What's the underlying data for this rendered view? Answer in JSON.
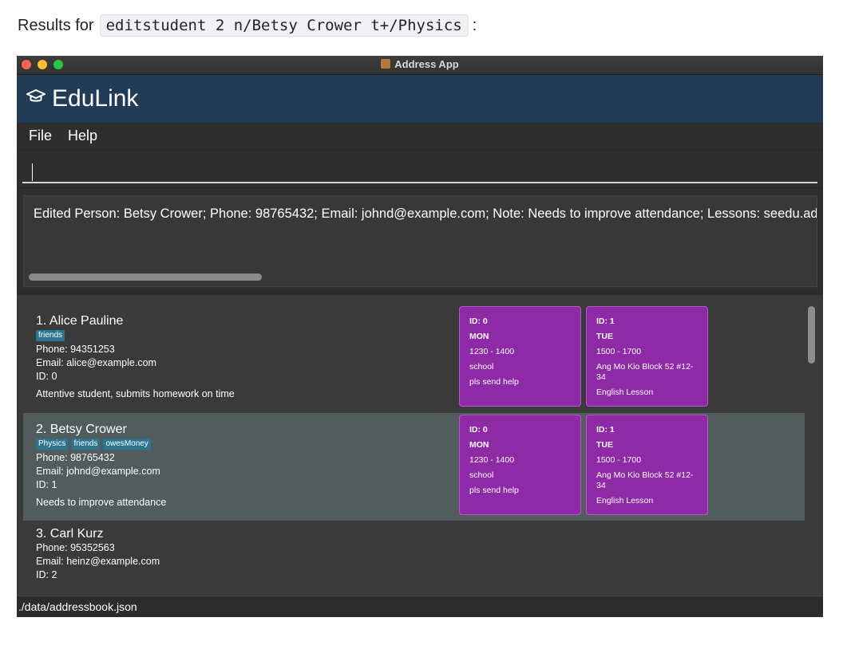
{
  "caption": {
    "prefix": "Results for",
    "command": "editstudent 2 n/Betsy Crower t+/Physics",
    "suffix": ":"
  },
  "window": {
    "title": "Address App"
  },
  "brand": {
    "icon": "graduation-cap-icon",
    "name": "EduLink"
  },
  "menu": {
    "file": "File",
    "help": "Help"
  },
  "command_box": {
    "value": "",
    "placeholder": ""
  },
  "result": {
    "text": "Edited Person: Betsy Crower; Phone: 98765432; Email: johnd@example.com; Note: Needs to improve attendance; Lessons: seedu.addressbook.model.lesson.Lesson"
  },
  "persons": [
    {
      "name": "1. Alice Pauline",
      "tags": [
        "friends"
      ],
      "phone": "Phone:  94351253",
      "email": "Email:  alice@example.com",
      "id": "ID:  0",
      "note": "Attentive student, submits homework on time",
      "lessons": [
        {
          "id": "ID: 0",
          "day": "MON",
          "time": "1230 - 1400",
          "location": "school",
          "subject": "pls send help"
        },
        {
          "id": "ID: 1",
          "day": "TUE",
          "time": "1500 - 1700",
          "location": "Ang Mo Kio Block 52 #12-34",
          "subject": "English Lesson"
        }
      ]
    },
    {
      "name": "2. Betsy Crower",
      "tags": [
        "Physics",
        "friends",
        "owesMoney"
      ],
      "phone": "Phone:  98765432",
      "email": "Email:  johnd@example.com",
      "id": "ID:  1",
      "note": "Needs to improve attendance",
      "lessons": [
        {
          "id": "ID: 0",
          "day": "MON",
          "time": "1230 - 1400",
          "location": "school",
          "subject": "pls send help"
        },
        {
          "id": "ID: 1",
          "day": "TUE",
          "time": "1500 - 1700",
          "location": "Ang Mo Kio Block 52 #12-34",
          "subject": "English Lesson"
        }
      ]
    },
    {
      "name": "3. Carl Kurz",
      "tags": [],
      "phone": "Phone:  95352563",
      "email": "Email:  heinz@example.com",
      "id": "ID:  2"
    }
  ],
  "status": {
    "path": "./data/addressbook.json"
  },
  "colors": {
    "header": "#213c54",
    "lesson_card": "#8e2aa6",
    "tag": "#2b7591",
    "selected_row": "#525c5c"
  }
}
